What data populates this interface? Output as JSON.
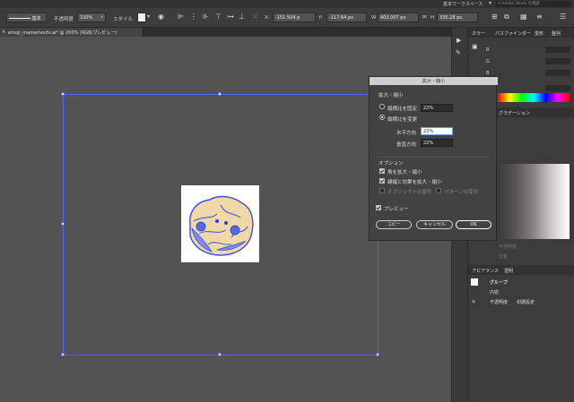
{
  "topbar": {
    "workspace": "基本ワークスペース",
    "search_placeholder": "Adobe Stock を検索"
  },
  "options": {
    "stroke_style": "基本",
    "opacity_label": "不透明度",
    "opacity_value": "100%",
    "style_label": "スタイル",
    "x_value": "-151.504 p",
    "y_value": "-117.64 px",
    "w_label": "W",
    "w_value": "403.007 px",
    "h_label": "H",
    "h_value": "335.28 px"
  },
  "document": {
    "tab_title": "emoji_mamemochi.ai* @ 200% (RGB/プレビュー)"
  },
  "dialog": {
    "title": "拡大・縮小",
    "section_scale": "拡大・縮小",
    "uniform_label": "縦横比を固定",
    "uniform_value": "22%",
    "nonuniform_label": "縦横比を変更",
    "horizontal_label": "水平方向",
    "horizontal_value": "22%",
    "vertical_label": "垂直方向",
    "vertical_value": "22%",
    "section_options": "オプション",
    "scale_corners": "角を拡大・縮小",
    "scale_strokes": "線幅と効果を拡大・縮小",
    "transform_objects": "オブジェクトの変形",
    "transform_patterns": "パターンの変形",
    "preview": "プレビュー",
    "copy_button": "コピー",
    "cancel_button": "キャンセル",
    "ok_button": "OK"
  },
  "panel": {
    "color_tab": "カラー",
    "pathfinder_tab": "パスファインダー",
    "transform_tab": "変形",
    "align_tab": "整列",
    "r_label": "R",
    "g_label": "G",
    "b_label": "B",
    "gradient_tab": "グラデーション",
    "opacity_label": "不透明度",
    "location_label": "位置",
    "appearance_tab": "アピアランス",
    "transparency_tab": "透明",
    "group_label": "グループ",
    "contents_label": "内容",
    "opacity_row_label": "不透明度",
    "opacity_row_value": "初期設定"
  },
  "colors": {
    "selection": "#4f64ff",
    "blob_fill": "#f0d8a8",
    "blob_stroke": "#3f4fe0"
  }
}
